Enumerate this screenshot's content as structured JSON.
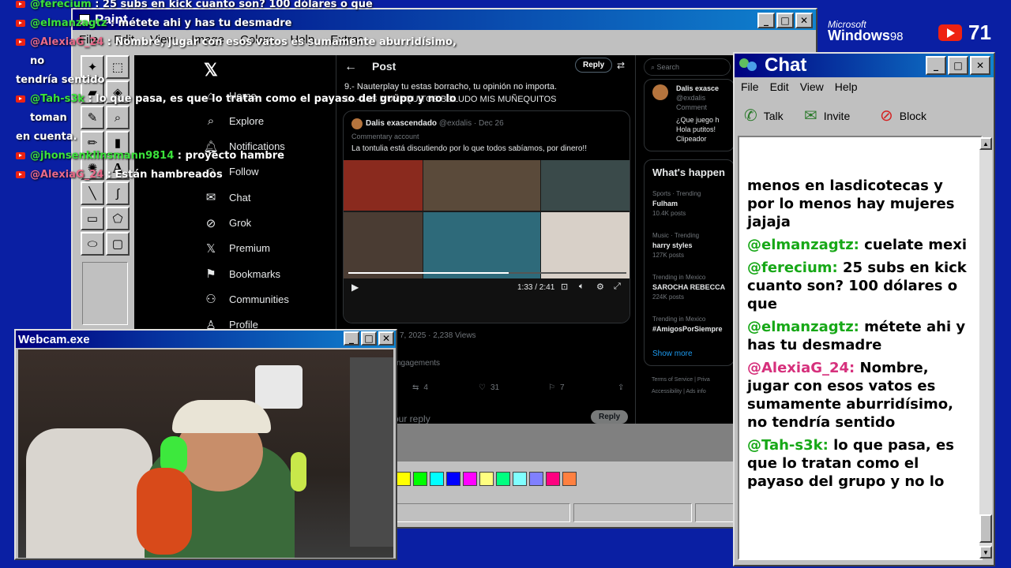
{
  "overlay_chat": [
    {
      "user": "@ferecium",
      "text": " : 25 subs en kick cuanto son? 100 dólares o que",
      "pink": false
    },
    {
      "user": "@elmanzagtz",
      "text": " : métete ahi y has tu desmadre",
      "pink": false
    },
    {
      "user": "@AlexiaG_24",
      "text": " : Nombre, jugar con esos vatos es sumamente aburridísimo, no",
      "pink": true
    },
    {
      "wrap": "tendría sentido"
    },
    {
      "user": "@Tah-s3k",
      "text": " : lo que pasa, es que lo tratan como el payaso del grupo y no lo toman",
      "pink": false
    },
    {
      "wrap": "en cuenta."
    },
    {
      "user": "@jhonsenklinsmann9814",
      "text": " : proyecto hambre",
      "pink": false
    },
    {
      "user": "@AlexiaG_24",
      "text": " : Están hambreados",
      "pink": true
    }
  ],
  "paint": {
    "title": "Paint",
    "menu": [
      "File",
      "Edit",
      "View",
      "Image",
      "Colors",
      "Help",
      "Extras"
    ],
    "palette": [
      "#ffff00",
      "#00ff00",
      "#00ffff",
      "#0000ff",
      "#ff00ff",
      "#ffff80",
      "#00ff80",
      "#80ffff",
      "#8080ff",
      "#ff0080",
      "#ff8040"
    ]
  },
  "x": {
    "nav": [
      "Home",
      "Explore",
      "Notifications",
      "Follow",
      "Chat",
      "Grok",
      "Premium",
      "Bookmarks",
      "Communities",
      "Profile"
    ],
    "nav_icons": [
      "home-icon",
      "search-icon",
      "bell-icon",
      "follow-icon",
      "chat-icon",
      "grok-icon",
      "x-logo-icon",
      "bookmark-icon",
      "communities-icon",
      "profile-icon"
    ],
    "header": "Post",
    "reply_label": "Reply",
    "lines": [
      "9.- Nauterplay tu estas borracho, tu opinión no importa.",
      "10.- MIS MUÑEQUITOS BOLUDO MIS MUÑEQUITOS"
    ],
    "quote_name": "Dalis exascendado",
    "quote_handle": "@exdalis · Dec 26",
    "quote_badge": "Commentary account",
    "quote_text": "La tontulia está discutiendo por lo que todos sabíamos, por dinero!!",
    "video_time": "1:33 / 2:41",
    "date_views": "7, 2025 · 2,238 Views",
    "engagements": "ngagements",
    "reposts": "4",
    "likes": "31",
    "bookmarks": "7",
    "your_reply": "our reply",
    "reply_btn": "Reply",
    "search_placeholder": "Search",
    "side_name": "Dalis exasce",
    "side_handle": "@exdalis",
    "side_badge": "Comment",
    "side_texts": [
      "¿Que juego h",
      "Hola putitos!",
      "Clipeador"
    ],
    "whats_happening": "What's happen",
    "trends": [
      {
        "cat": "Sports · Trending",
        "name": "Fulham",
        "count": "10.4K posts"
      },
      {
        "cat": "Music · Trending",
        "name": "harry styles",
        "count": "127K posts"
      },
      {
        "cat": "Trending in Mexico",
        "name": "SAROCHA REBECCA",
        "count": "224K posts"
      },
      {
        "cat": "Trending in Mexico",
        "name": "#AmigosPorSiempre",
        "count": ""
      }
    ],
    "show_more": "Show more",
    "footer1": "Terms of Service |  Priva",
    "footer2": "Accessibility |  Ads info"
  },
  "webcam": {
    "title": "Webcam.exe"
  },
  "chat": {
    "title": "Chat",
    "menu": [
      "File",
      "Edit",
      "View",
      "Help"
    ],
    "buttons": [
      "Talk",
      "Invite",
      "Block"
    ],
    "messages": [
      {
        "user": "",
        "text": "menos en lasdicotecas y por lo menos hay mujeres jajaja",
        "pink": false
      },
      {
        "user": "@elmanzagtz:",
        "text": " cuelate mexi",
        "pink": false
      },
      {
        "user": "@ferecium:",
        "text": " 25 subs en kick cuanto son? 100 dólares o que",
        "pink": false
      },
      {
        "user": "@elmanzagtz:",
        "text": " métete ahi y has tu desmadre",
        "pink": false
      },
      {
        "user": "@AlexiaG_24:",
        "text": " Nombre, jugar con esos vatos es sumamente aburridísimo, no tendría sentido",
        "pink": true
      },
      {
        "user": "@Tah-s3k:",
        "text": " lo que pasa, es que lo tratan como el payaso del grupo y no lo",
        "pink": false
      }
    ]
  },
  "brand": {
    "microsoft": "Microsoft",
    "windows": "Windows",
    "version": "98"
  },
  "yt_count": "71",
  "colors": {
    "win_blue": "#000080",
    "desktop": "#0a1fa3",
    "x_bg": "#000000",
    "chat_green": "#17a817",
    "chat_pink": "#d6307c"
  }
}
